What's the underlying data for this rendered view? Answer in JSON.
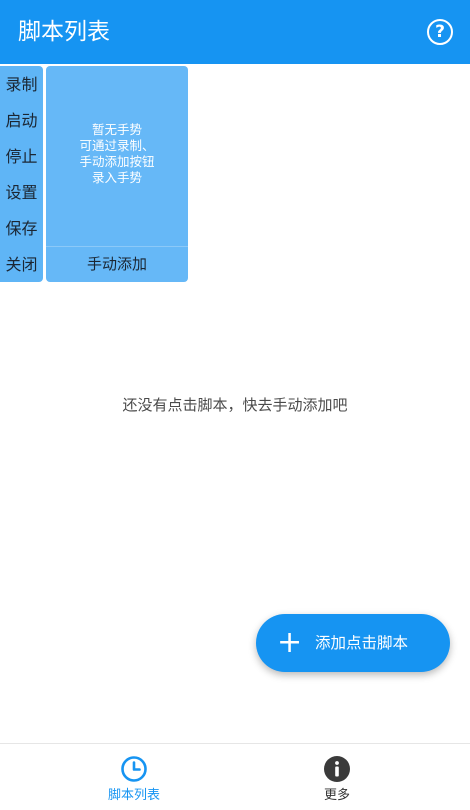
{
  "app_bar": {
    "title": "脚本列表",
    "help_icon": "?"
  },
  "floating_panel": {
    "menu_items": [
      "录制",
      "启动",
      "停止",
      "设置",
      "保存",
      "关闭"
    ],
    "gesture_empty_lines": [
      "暂无手势",
      "可通过录制、",
      "手动添加按钮",
      "录入手势"
    ],
    "manual_add_label": "手动添加"
  },
  "main": {
    "empty_hint": "还没有点击脚本，快去手动添加吧"
  },
  "fab": {
    "icon": "+",
    "label": "添加点击脚本"
  },
  "bottom_nav": {
    "items": [
      {
        "label": "脚本列表",
        "icon": "clock-icon",
        "active": true
      },
      {
        "label": "更多",
        "icon": "info-icon",
        "active": false
      }
    ]
  },
  "colors": {
    "primary": "#1694f2",
    "panel": "#66b8f7",
    "side_menu": "#5fb5f6"
  }
}
